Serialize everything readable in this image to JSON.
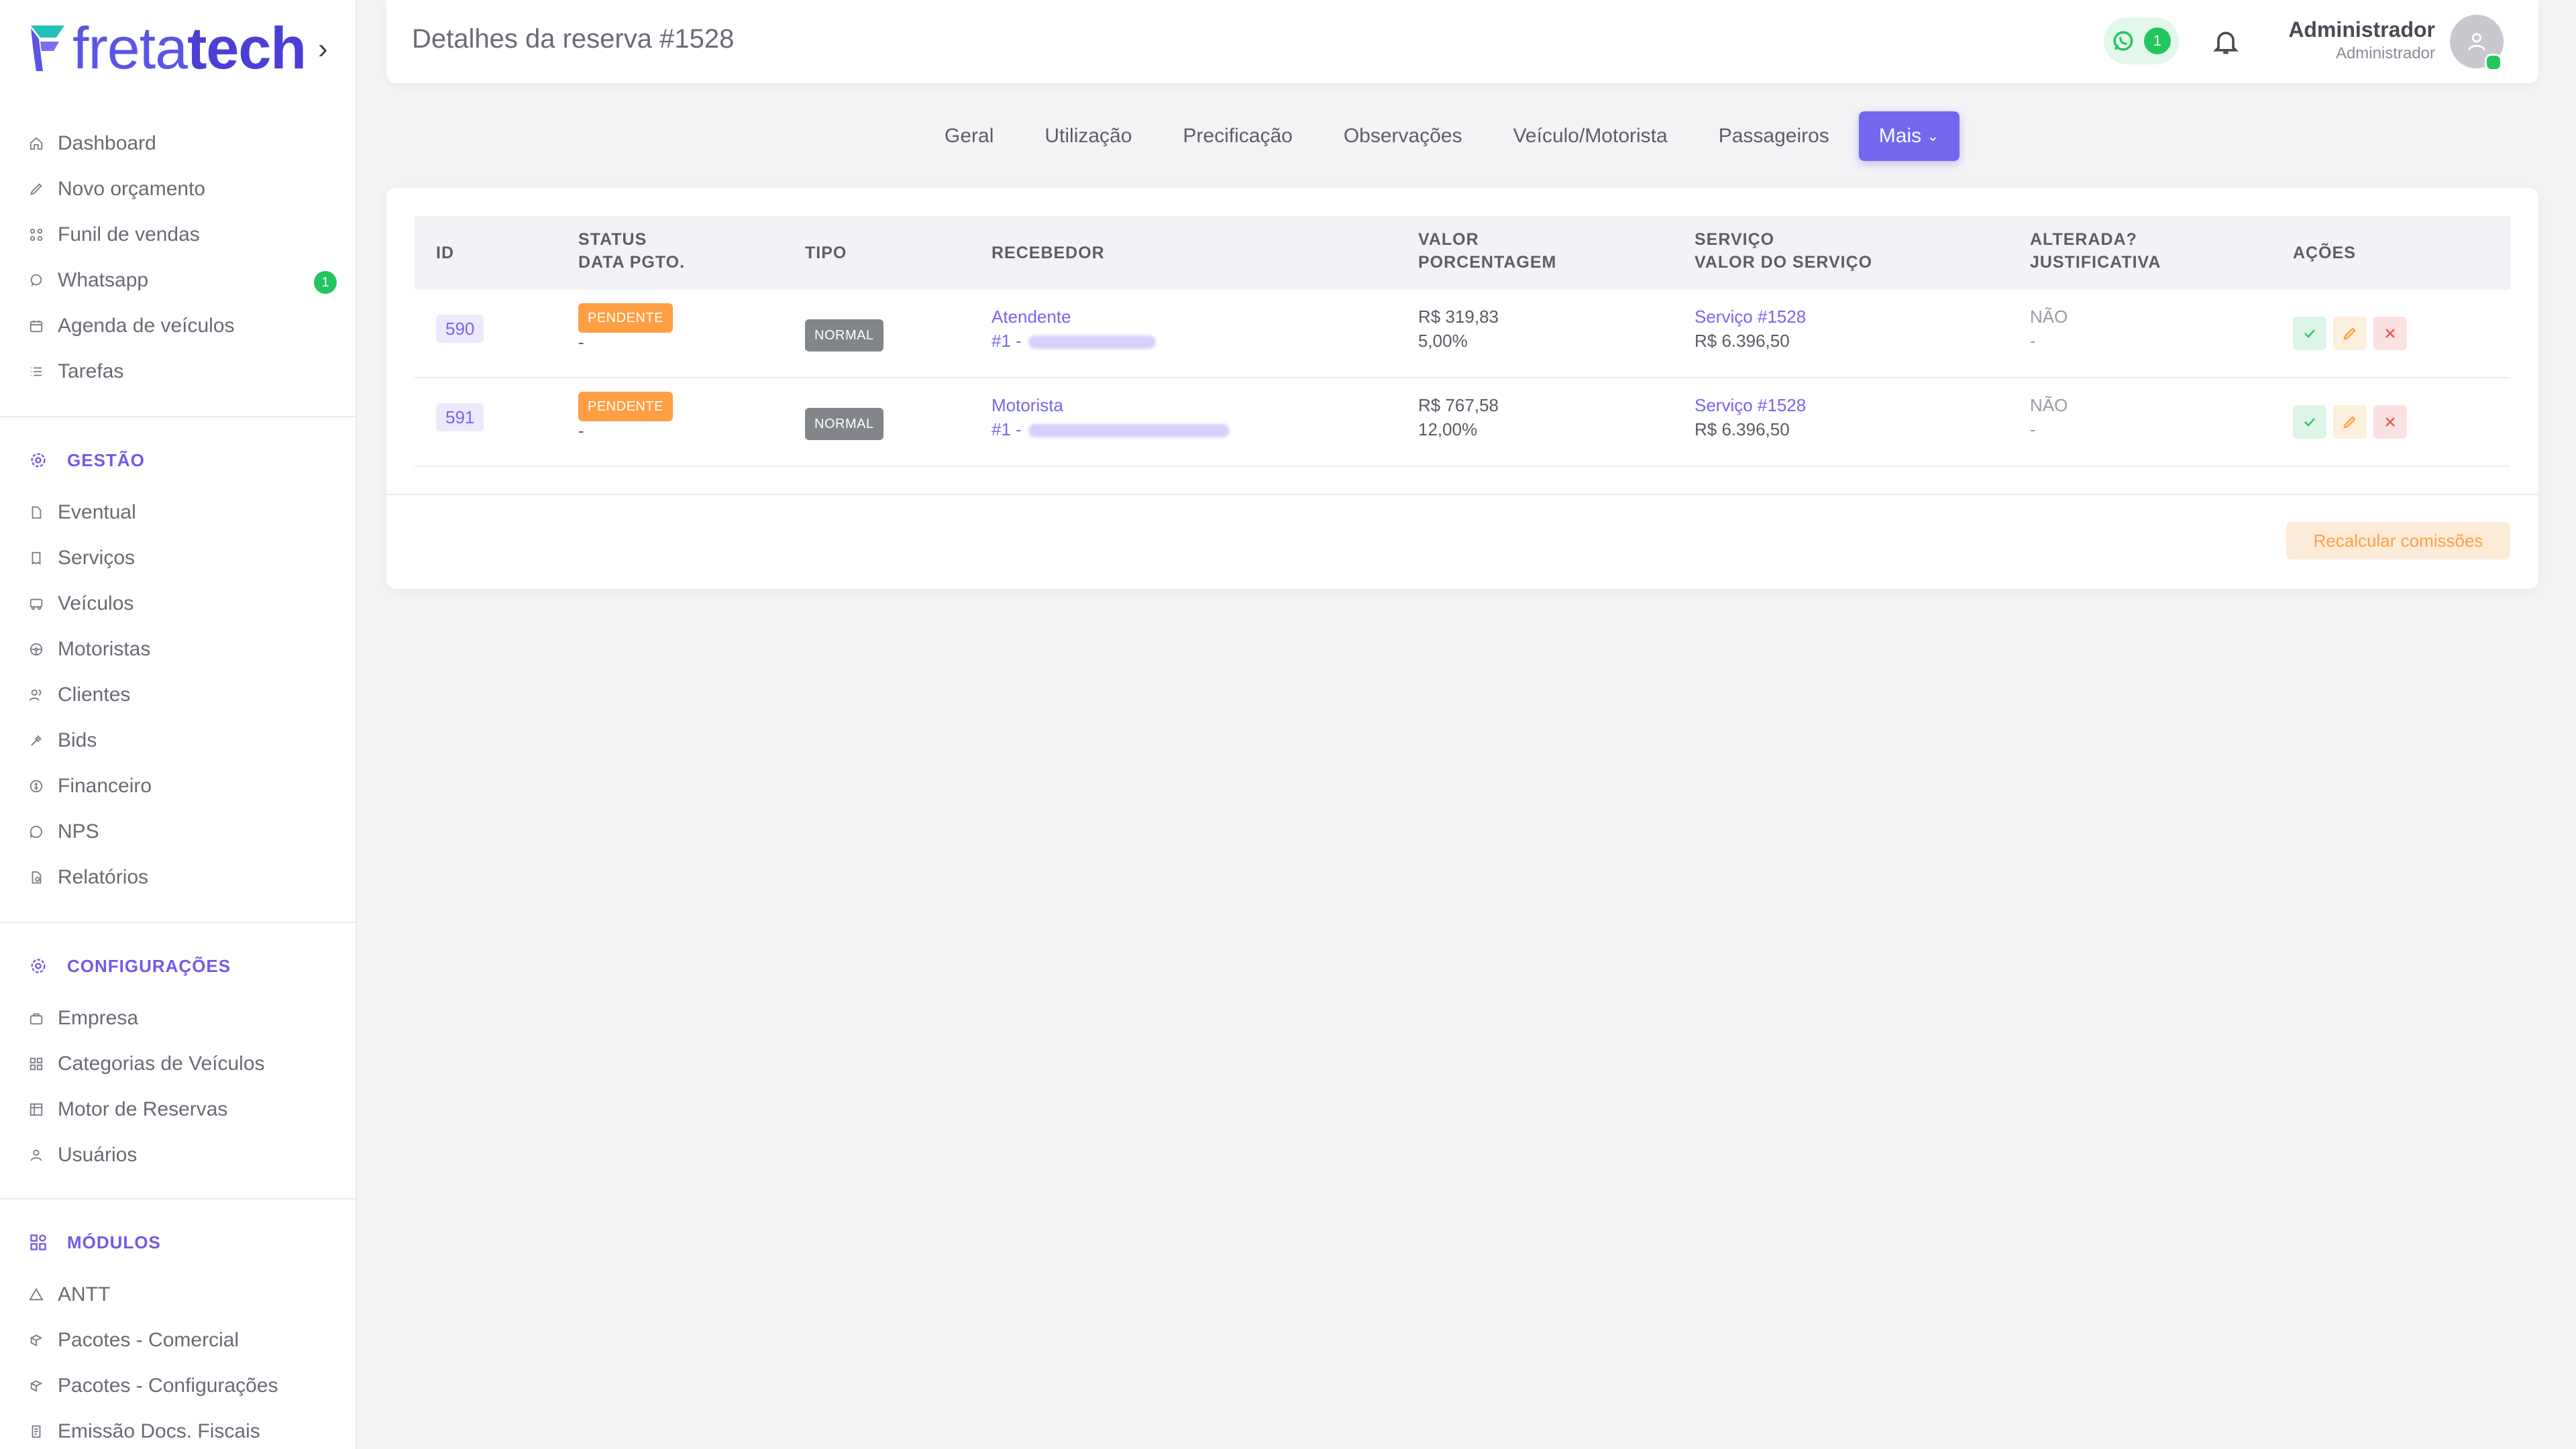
{
  "brand": {
    "light": "freta",
    "bold": "tech"
  },
  "sidebar": {
    "top_items": [
      {
        "label": "Dashboard",
        "icon": "home-icon"
      },
      {
        "label": "Novo orçamento",
        "icon": "edit-icon"
      },
      {
        "label": "Funil de vendas",
        "icon": "funnel-icon"
      },
      {
        "label": "Whatsapp",
        "icon": "chat-icon",
        "badge": "1"
      },
      {
        "label": "Agenda de veículos",
        "icon": "calendar-icon"
      },
      {
        "label": "Tarefas",
        "icon": "list-icon"
      }
    ],
    "gestao": {
      "title": "GESTÃO",
      "items": [
        {
          "label": "Eventual",
          "icon": "file-icon"
        },
        {
          "label": "Serviços",
          "icon": "receipt-icon"
        },
        {
          "label": "Veículos",
          "icon": "bus-icon"
        },
        {
          "label": "Motoristas",
          "icon": "steering-wheel-icon"
        },
        {
          "label": "Clientes",
          "icon": "users-icon"
        },
        {
          "label": "Bids",
          "icon": "gavel-icon"
        },
        {
          "label": "Financeiro",
          "icon": "coin-icon"
        },
        {
          "label": "NPS",
          "icon": "message-icon"
        },
        {
          "label": "Relatórios",
          "icon": "report-icon"
        }
      ]
    },
    "config": {
      "title": "CONFIGURAÇÕES",
      "items": [
        {
          "label": "Empresa",
          "icon": "building-icon"
        },
        {
          "label": "Categorias de Veículos",
          "icon": "grid-icon"
        },
        {
          "label": "Motor de Reservas",
          "icon": "table-icon"
        },
        {
          "label": "Usuários",
          "icon": "user-icon"
        }
      ]
    },
    "modulos": {
      "title": "MÓDULOS",
      "items": [
        {
          "label": "ANTT",
          "icon": "triangle-icon"
        },
        {
          "label": "Pacotes - Comercial",
          "icon": "package-icon"
        },
        {
          "label": "Pacotes - Configurações",
          "icon": "package-icon"
        },
        {
          "label": "Emissão Docs. Fiscais",
          "icon": "document-icon"
        }
      ]
    }
  },
  "header": {
    "title": "Detalhes da reserva #1528",
    "whatsapp_count": "1",
    "user_name": "Administrador",
    "user_role": "Administrador"
  },
  "tabs": [
    "Geral",
    "Utilização",
    "Precificação",
    "Observações",
    "Veículo/Motorista",
    "Passageiros"
  ],
  "tab_more": "Mais",
  "table": {
    "headers": {
      "id": "ID",
      "status1": "STATUS",
      "status2": "DATA PGTO.",
      "tipo": "TIPO",
      "recebedor": "RECEBEDOR",
      "valor1": "VALOR",
      "valor2": "PORCENTAGEM",
      "servico1": "SERVIÇO",
      "servico2": "VALOR DO SERVIÇO",
      "alterada1": "ALTERADA?",
      "alterada2": "JUSTIFICATIVA",
      "acoes": "AÇÕES"
    },
    "rows": [
      {
        "id": "590",
        "status": "PENDENTE",
        "data_pgto": "-",
        "tipo": "NORMAL",
        "recebedor": "Atendente",
        "recebedor_ref": "#1 -",
        "valor": "R$ 319,83",
        "porcentagem": "5,00%",
        "servico": "Serviço #1528",
        "valor_servico": "R$ 6.396,50",
        "alterada": "NÃO",
        "justificativa": "-"
      },
      {
        "id": "591",
        "status": "PENDENTE",
        "data_pgto": "-",
        "tipo": "NORMAL",
        "recebedor": "Motorista",
        "recebedor_ref": "#1 -",
        "valor": "R$ 767,58",
        "porcentagem": "12,00%",
        "servico": "Serviço #1528",
        "valor_servico": "R$ 6.396,50",
        "alterada": "NÃO",
        "justificativa": "-"
      }
    ]
  },
  "recalc_label": "Recalcular comissões",
  "colors": {
    "accent": "#7367f0",
    "success": "#22c55e",
    "warning": "#ff9f43",
    "danger": "#ea5455"
  }
}
